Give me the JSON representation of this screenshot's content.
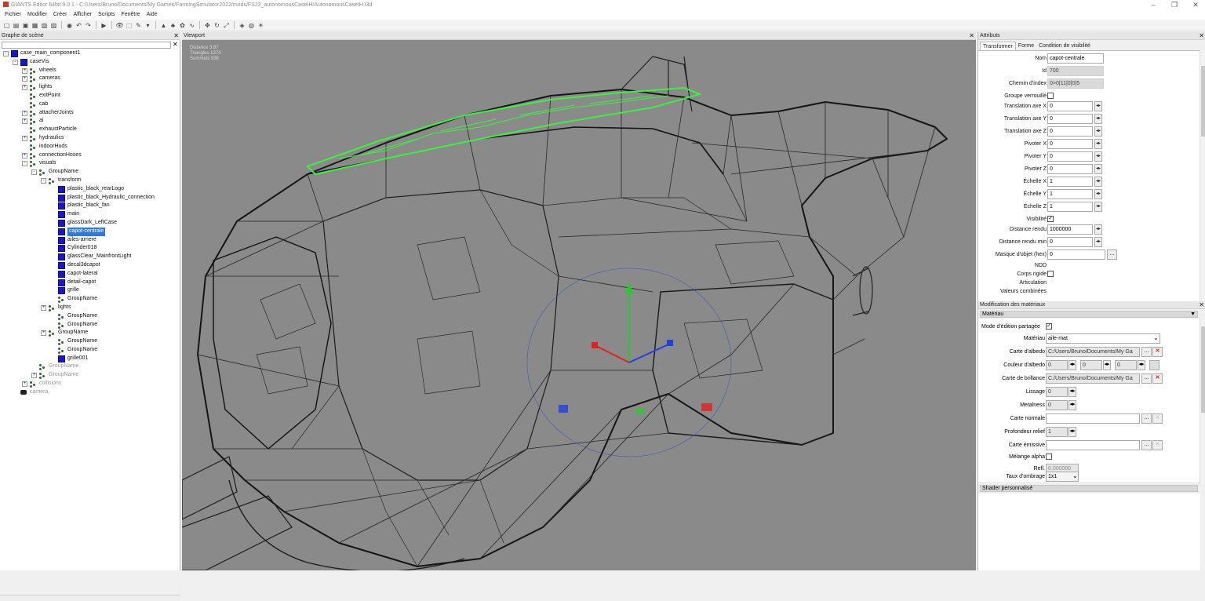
{
  "window": {
    "title": "GIANTS Editor 64bit 9.0.1 - C:/Users/Bruno/Documents/My Games/FarmingSimulator2022/mods/FS22_autonomousCaseIH/AutonomousCaseIH.i3d",
    "controls": {
      "minimize": "–",
      "maximize": "❐",
      "close": "✕"
    }
  },
  "menu": [
    "Fichier",
    "Modifier",
    "Créer",
    "Afficher",
    "Scripts",
    "Fenêtre",
    "Aide"
  ],
  "toolbar_icons": [
    "new-file-icon",
    "open-icon",
    "save-icon",
    "save-all-icon",
    "import-icon",
    "export-icon",
    "render-icon",
    "undo-icon",
    "redo-icon",
    "play-icon",
    "eye-icon",
    "select-icon",
    "paint-icon",
    "dropdown-icon",
    "terrain-icon",
    "foliage-icon",
    "paint-foliage-icon",
    "spline-icon",
    "move-icon",
    "rotate-icon",
    "scale-icon",
    "camera-icon",
    "world-icon",
    "light-icon"
  ],
  "toolbar_glyphs": [
    "▢",
    "▤",
    "▣",
    "▦",
    "▧",
    "▨",
    "◉",
    "↶",
    "↷",
    "▶",
    "👁",
    "⬚",
    "✎",
    "▾",
    "▲",
    "♣",
    "✿",
    "∿",
    "✥",
    "↻",
    "⤢",
    "◈",
    "◍",
    "☀"
  ],
  "scene": {
    "title": "Graphe de scène",
    "close": "✕",
    "nodes": [
      {
        "label": "case_main_component1",
        "level": 0,
        "icon": "cube",
        "exp": "-"
      },
      {
        "label": "caseVis",
        "level": 1,
        "icon": "cube",
        "exp": "-"
      },
      {
        "label": "wheels",
        "level": 2,
        "icon": "group",
        "exp": "+"
      },
      {
        "label": "cameras",
        "level": 2,
        "icon": "group",
        "exp": "+"
      },
      {
        "label": "lights",
        "level": 2,
        "icon": "group",
        "exp": "+"
      },
      {
        "label": "exitPoint",
        "level": 2,
        "icon": "group",
        "exp": ""
      },
      {
        "label": "cab",
        "level": 2,
        "icon": "group",
        "exp": ""
      },
      {
        "label": "attacherJoints",
        "level": 2,
        "icon": "group",
        "exp": "+"
      },
      {
        "label": "ai",
        "level": 2,
        "icon": "group",
        "exp": "+"
      },
      {
        "label": "exhaustParticle",
        "level": 2,
        "icon": "group",
        "exp": ""
      },
      {
        "label": "hydraulics",
        "level": 2,
        "icon": "group",
        "exp": "+"
      },
      {
        "label": "indoorHuds",
        "level": 2,
        "icon": "group",
        "exp": ""
      },
      {
        "label": "connectionHoses",
        "level": 2,
        "icon": "group",
        "exp": "+"
      },
      {
        "label": "visuals",
        "level": 2,
        "icon": "group",
        "exp": "-"
      },
      {
        "label": "GroupName",
        "level": 3,
        "icon": "group",
        "exp": "-"
      },
      {
        "label": "transform",
        "level": 4,
        "icon": "group",
        "exp": "-"
      },
      {
        "label": "plastic_black_rearLogo",
        "level": 5,
        "icon": "cube",
        "exp": ""
      },
      {
        "label": "plastic_black_Hydraulic_connection",
        "level": 5,
        "icon": "cube",
        "exp": ""
      },
      {
        "label": "plastic_black_fan",
        "level": 5,
        "icon": "cube",
        "exp": ""
      },
      {
        "label": "main",
        "level": 5,
        "icon": "cube",
        "exp": ""
      },
      {
        "label": "glassDark_LeftCase",
        "level": 5,
        "icon": "cube",
        "exp": ""
      },
      {
        "label": "capot-centrale",
        "level": 5,
        "icon": "cube",
        "exp": "",
        "selected": true
      },
      {
        "label": "ailes-arriere",
        "level": 5,
        "icon": "cube",
        "exp": ""
      },
      {
        "label": "Cylinder018",
        "level": 5,
        "icon": "cube",
        "exp": ""
      },
      {
        "label": "glassClear_MainfrontLight",
        "level": 5,
        "icon": "cube",
        "exp": ""
      },
      {
        "label": "decal3dcapot",
        "level": 5,
        "icon": "cube",
        "exp": ""
      },
      {
        "label": "capot-lateral",
        "level": 5,
        "icon": "cube",
        "exp": ""
      },
      {
        "label": "detail-capot",
        "level": 5,
        "icon": "cube",
        "exp": ""
      },
      {
        "label": "grille",
        "level": 5,
        "icon": "cube",
        "exp": ""
      },
      {
        "label": "GroupName",
        "level": 5,
        "icon": "group",
        "exp": ""
      },
      {
        "label": "lights",
        "level": 4,
        "icon": "group",
        "exp": "+"
      },
      {
        "label": "GroupName",
        "level": 5,
        "icon": "group",
        "exp": ""
      },
      {
        "label": "GroupName",
        "level": 5,
        "icon": "group",
        "exp": ""
      },
      {
        "label": "GroupName",
        "level": 4,
        "icon": "group",
        "exp": "+"
      },
      {
        "label": "GroupName",
        "level": 5,
        "icon": "group",
        "exp": ""
      },
      {
        "label": "GroupName",
        "level": 5,
        "icon": "group",
        "exp": ""
      },
      {
        "label": "grille001",
        "level": 5,
        "icon": "cube",
        "exp": ""
      },
      {
        "label": "GroupName",
        "level": 3,
        "icon": "group",
        "exp": "",
        "dim": true
      },
      {
        "label": "GroupName",
        "level": 3,
        "icon": "group",
        "exp": "+",
        "dim": true
      },
      {
        "label": "collisions",
        "level": 2,
        "icon": "group",
        "exp": "+",
        "dim": true
      },
      {
        "label": "camera",
        "level": 1,
        "icon": "camera",
        "exp": "",
        "dim": true
      }
    ]
  },
  "viewport": {
    "title": "Viewport",
    "close": "✕",
    "stats": [
      "Distance 3.87",
      "Triangles 1374",
      "Sommets 936"
    ],
    "colors": {
      "bg": "#8a8a8a",
      "wire": "#1a1a1a",
      "selected": "#3df03d",
      "gizmo_red": "#e02020",
      "gizmo_green": "#20d020",
      "gizmo_blue": "#2040e0"
    }
  },
  "attributes": {
    "title": "Attributs",
    "close": "✕",
    "tabs": [
      "Transformer",
      "Forme",
      "Condition de visibilité"
    ],
    "active_tab": "Transformer",
    "fields": {
      "nom": {
        "label": "Nom",
        "value": "capot-centrale"
      },
      "id": {
        "label": "Id",
        "value": "700"
      },
      "chemin": {
        "label": "Chemin d'index",
        "value": "0>0|11|0|0|5"
      },
      "groupe": {
        "label": "Groupe verrouillé"
      },
      "tx": {
        "label": "Translation axe X",
        "value": "0"
      },
      "ty": {
        "label": "Translation axe Y",
        "value": "0"
      },
      "tz": {
        "label": "Translation axe Z",
        "value": "0"
      },
      "rx": {
        "label": "Pivoter X",
        "value": "0"
      },
      "ry": {
        "label": "Pivoter Y",
        "value": "0"
      },
      "rz": {
        "label": "Pivoter Z",
        "value": "0"
      },
      "sx": {
        "label": "Échelle X",
        "value": "1"
      },
      "sy": {
        "label": "Échelle Y",
        "value": "1"
      },
      "sz": {
        "label": "Échelle Z",
        "value": "1"
      },
      "visibilite": {
        "label": "Visibilité",
        "checked": "✓"
      },
      "dist": {
        "label": "Distance rendu",
        "value": "1000000"
      },
      "distmin": {
        "label": "Distance rendu min",
        "value": "0"
      },
      "masque": {
        "label": "Masque d'objet (hex)",
        "value": "0"
      },
      "ndd": {
        "label": "NDD"
      },
      "corps": {
        "label": "Corps rigide"
      },
      "articulation": {
        "label": "Articulation"
      },
      "valeurs": {
        "label": "Valeurs combinées"
      }
    },
    "spin_glyph": "◂▸",
    "dots_glyph": "..."
  },
  "material": {
    "title": "Modification des matériaux",
    "close": "✕",
    "section": "Matériau",
    "section_arrow": "▼",
    "fields": {
      "mode": {
        "label": "Mode d'édition partagée",
        "checked": "✓"
      },
      "materiau": {
        "label": "Matériau",
        "value": "aile-mat",
        "arrow": "⌄"
      },
      "albedo": {
        "label": "Carte d'albedo",
        "value": "C:/Users/Bruno/Documents/My Ga"
      },
      "couleur": {
        "label": "Couleur d'albedo",
        "values": [
          "0",
          "0",
          "0"
        ]
      },
      "brillance": {
        "label": "Carte de brillance",
        "value": "C:/Users/Bruno/Documents/My Ga"
      },
      "lissage": {
        "label": "Lissage",
        "value": "0"
      },
      "metalness": {
        "label": "Metalness",
        "value": "0"
      },
      "normale": {
        "label": "Carte normale",
        "value": ""
      },
      "profondeur": {
        "label": "Profondeur relief",
        "value": "1"
      },
      "emissive": {
        "label": "Carte émissive",
        "value": ""
      },
      "melange": {
        "label": "Mélange alpha"
      },
      "refl": {
        "label": "Refl.",
        "value": "0.000000"
      },
      "ombrage": {
        "label": "Taux d'ombrage",
        "value": "1x1",
        "arrow": "⌄"
      }
    },
    "shader_section": "Shader personnalisé",
    "remove_glyph": "✕"
  }
}
